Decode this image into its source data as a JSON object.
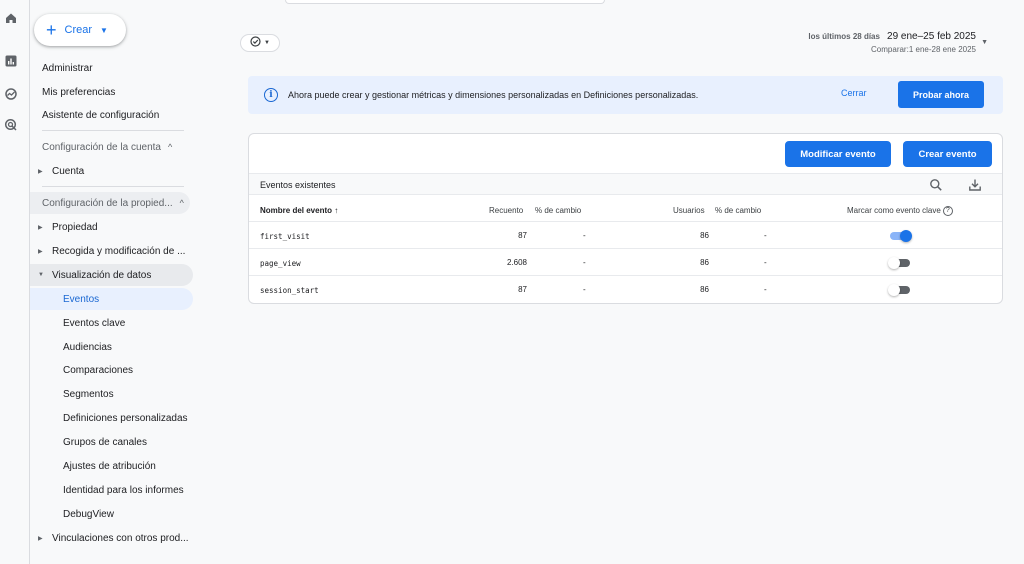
{
  "nav": {
    "create_label": "Crear",
    "admin": "Administrar",
    "prefs": "Mis preferencias",
    "setup": "Asistente de configuración",
    "account_group": "Configuración de la cuenta",
    "account": "Cuenta",
    "property_group": "Configuración de la propied...",
    "property": "Propiedad",
    "collection": "Recogida y modificación de ...",
    "display": "Visualización de datos",
    "sub": [
      "Eventos",
      "Eventos clave",
      "Audiencias",
      "Comparaciones",
      "Segmentos",
      "Definiciones personalizadas",
      "Grupos de canales",
      "Ajustes de atribución",
      "Identidad para los informes",
      "DebugView"
    ],
    "links": "Vinculaciones con otros prod..."
  },
  "date": {
    "label": "los últimos 28 días",
    "range": "29 ene–25 feb 2025",
    "compare": "Comparar:1 ene-28 ene 2025"
  },
  "banner": {
    "message": "Ahora puede crear y gestionar métricas y dimensiones personalizadas en Definiciones personalizadas.",
    "close": "Cerrar",
    "try": "Probar ahora"
  },
  "card": {
    "modify": "Modificar evento",
    "create": "Crear evento",
    "subtitle": "Eventos existentes",
    "columns": {
      "name": "Nombre del evento ↑",
      "count": "Recuento",
      "count_change": "% de cambio",
      "users": "Usuarios",
      "users_change": "% de cambio",
      "key": "Marcar como evento clave"
    },
    "rows": [
      {
        "name": "first_visit",
        "count": "87",
        "count_change": "-",
        "users": "86",
        "users_change": "-",
        "key_event": true
      },
      {
        "name": "page_view",
        "count": "2.608",
        "count_change": "-",
        "users": "86",
        "users_change": "-",
        "key_event": false
      },
      {
        "name": "session_start",
        "count": "87",
        "count_change": "-",
        "users": "86",
        "users_change": "-",
        "key_event": false
      }
    ]
  },
  "colors": {
    "accent": "#1a73e8",
    "active_bg": "#e8f0fe",
    "banner_bg": "#e8f0fe"
  },
  "icons": [
    "home-icon",
    "reports-icon",
    "explore-icon",
    "advertising-icon",
    "check-circle-icon",
    "search-icon",
    "download-icon",
    "info-icon",
    "help-icon"
  ]
}
